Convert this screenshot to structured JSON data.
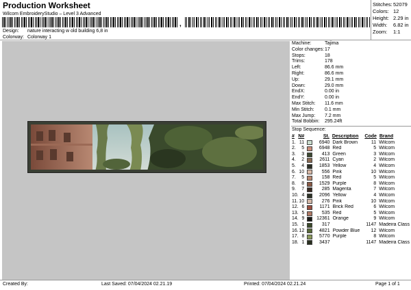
{
  "header": {
    "title": "Production Worksheet",
    "subtitle": "Wilcom EmbroideryStudio – Level 3 Advanced",
    "barcode_separator": ","
  },
  "meta": {
    "design_label": "Design:",
    "design_value": "nature interacting w old building 6,8 in",
    "colorway_label": "Colorway:",
    "colorway_value": "Colorway 1"
  },
  "summary": [
    {
      "label": "Stitches:",
      "value": "52079"
    },
    {
      "label": "Colors:",
      "value": "12"
    },
    {
      "label": "Height:",
      "value": "2.29 in"
    },
    {
      "label": "Width:",
      "value": "6.82 in"
    },
    {
      "label": "Zoom:",
      "value": "1:1"
    }
  ],
  "specs": [
    {
      "label": "Machine:",
      "value": "Tajima"
    },
    {
      "label": "Color changes:",
      "value": "17"
    },
    {
      "label": "Stops:",
      "value": "18"
    },
    {
      "label": "Trims:",
      "value": "178"
    },
    {
      "label": "Left:",
      "value": "86.6 mm"
    },
    {
      "label": "Right:",
      "value": "86.6 mm"
    },
    {
      "label": "Up:",
      "value": "29.1 mm"
    },
    {
      "label": "Down:",
      "value": "29.0 mm"
    },
    {
      "label": "EndX:",
      "value": "0.00 in"
    },
    {
      "label": "EndY:",
      "value": "0.00 in"
    },
    {
      "label": "Max Stitch:",
      "value": "11.6 mm"
    },
    {
      "label": "Min Stitch:",
      "value": "0.1 mm"
    },
    {
      "label": "Max Jump:",
      "value": "7.2 mm"
    },
    {
      "label": "Total Bobbin:",
      "value": "295.24ft"
    }
  ],
  "stop_sequence": {
    "heading": "Stop Sequence:",
    "columns": [
      "#",
      "N#",
      "St.",
      "Description",
      "Code",
      "Brand"
    ],
    "rows": [
      {
        "num": "1.",
        "n": "11",
        "color": "#c9dccd",
        "st": "6940",
        "desc": "Dark Brown",
        "code": "11",
        "brand": "Wilcom"
      },
      {
        "num": "2.",
        "n": "5",
        "color": "#c98c7a",
        "st": "6948",
        "desc": "Red",
        "code": "5",
        "brand": "Wilcom"
      },
      {
        "num": "3.",
        "n": "3",
        "color": "#3d4a33",
        "st": "413",
        "desc": "Green",
        "code": "3",
        "brand": "Wilcom"
      },
      {
        "num": "4.",
        "n": "2",
        "color": "#8a6a52",
        "st": "2611",
        "desc": "Cyan",
        "code": "2",
        "brand": "Wilcom"
      },
      {
        "num": "5.",
        "n": "4",
        "color": "#2c2f24",
        "st": "1853",
        "desc": "Yellow",
        "code": "4",
        "brand": "Wilcom"
      },
      {
        "num": "6.",
        "n": "10",
        "color": "#d8b8a6",
        "st": "556",
        "desc": "Pink",
        "code": "10",
        "brand": "Wilcom"
      },
      {
        "num": "7.",
        "n": "5",
        "color": "#b88870",
        "st": "158",
        "desc": "Red",
        "code": "5",
        "brand": "Wilcom"
      },
      {
        "num": "8.",
        "n": "8",
        "color": "#8a5a45",
        "st": "1529",
        "desc": "Purple",
        "code": "8",
        "brand": "Wilcom"
      },
      {
        "num": "9.",
        "n": "7",
        "color": "#3a2a22",
        "st": "285",
        "desc": "Magenta",
        "code": "7",
        "brand": "Wilcom"
      },
      {
        "num": "10.",
        "n": "4",
        "color": "#2e3326",
        "st": "2096",
        "desc": "Yellow",
        "code": "4",
        "brand": "Wilcom"
      },
      {
        "num": "11.",
        "n": "10",
        "color": "#d4b8a8",
        "st": "276",
        "desc": "Pink",
        "code": "10",
        "brand": "Wilcom"
      },
      {
        "num": "12.",
        "n": "6",
        "color": "#9a5040",
        "st": "1171",
        "desc": "Brick Red",
        "code": "6",
        "brand": "Wilcom"
      },
      {
        "num": "13.",
        "n": "5",
        "color": "#b07a66",
        "st": "535",
        "desc": "Red",
        "code": "5",
        "brand": "Wilcom"
      },
      {
        "num": "14.",
        "n": "9",
        "color": "#1a1a16",
        "st": "12361",
        "desc": "Orange",
        "code": "9",
        "brand": "Wilcom"
      },
      {
        "num": "15.",
        "n": "1",
        "color": "#3b4a2a",
        "st": "317",
        "desc": "",
        "code": "1147",
        "brand": "Madeira Classic 40"
      },
      {
        "num": "16.",
        "n": "12",
        "color": "#5a6a3a",
        "st": "4821",
        "desc": "Powder Blue",
        "code": "12",
        "brand": "Wilcom"
      },
      {
        "num": "17.",
        "n": "8",
        "color": "#8a9a5a",
        "st": "5770",
        "desc": "Purple",
        "code": "8",
        "brand": "Wilcom"
      },
      {
        "num": "18.",
        "n": "1",
        "color": "#2a3020",
        "st": "3437",
        "desc": "",
        "code": "1147",
        "brand": "Madeira Classic 40"
      }
    ]
  },
  "footer": {
    "created_by": "Created By:",
    "last_saved": "Last Saved: 07/04/2024 02.21.19",
    "printed": "Printed: 07/04/2024 02.21.24",
    "page": "Page 1 of 1"
  },
  "colors": {
    "canvas_bg": "#c5c5c5",
    "hoop_frame": "#3a3f34"
  }
}
